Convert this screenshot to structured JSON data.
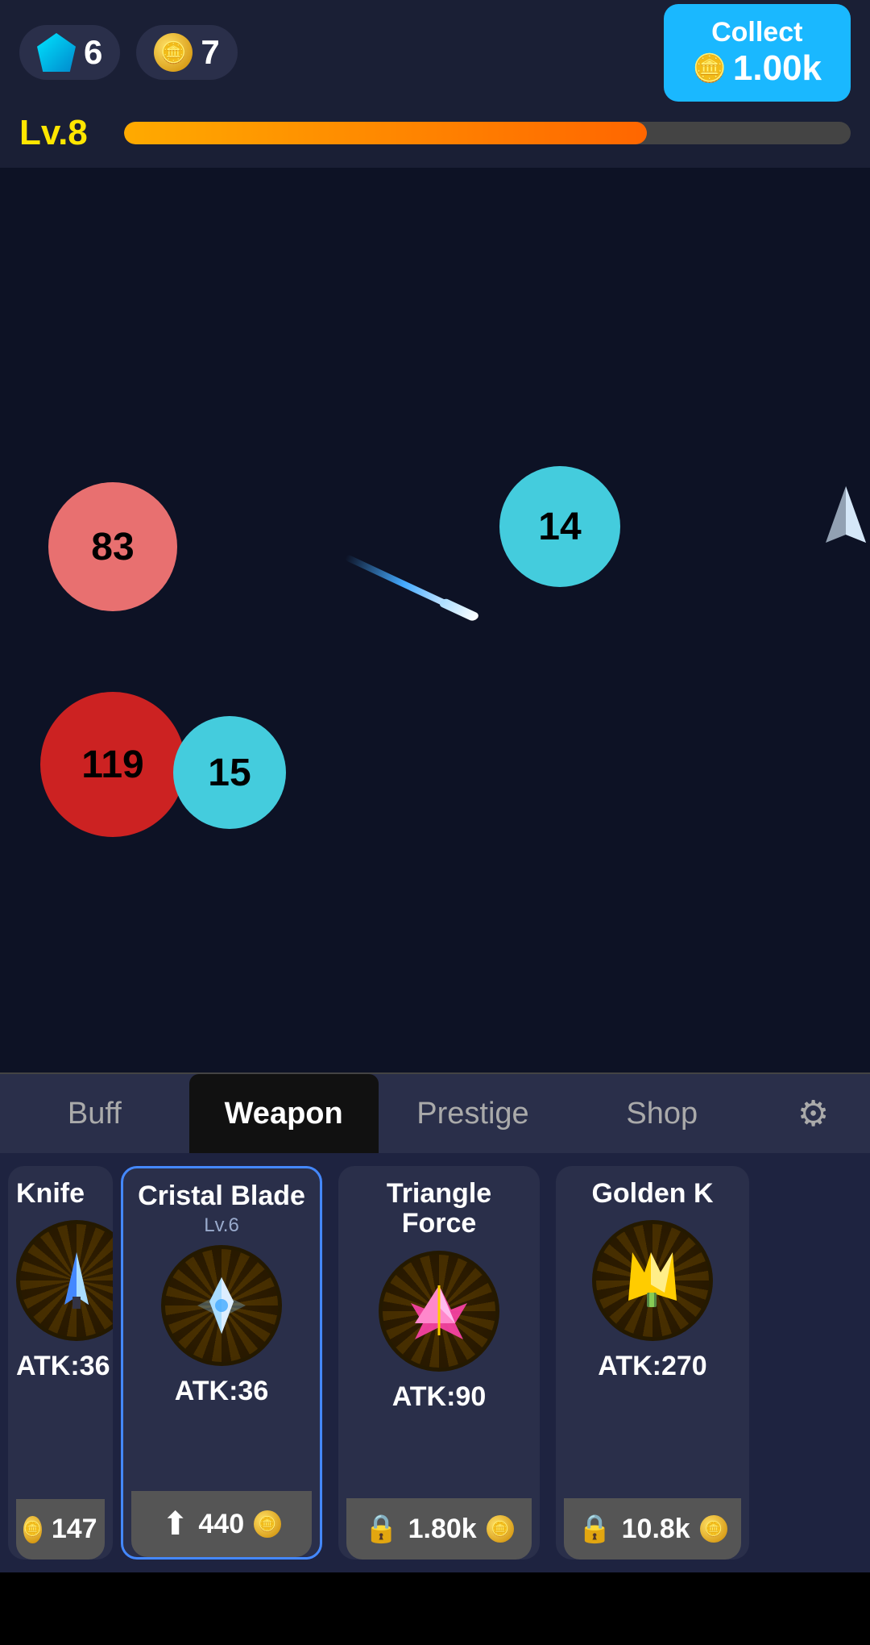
{
  "topbar": {
    "diamond_count": "6",
    "coin_count": "7",
    "collect_label": "Collect",
    "collect_amount": "1.00k"
  },
  "level": {
    "label": "Lv.8",
    "xp_percent": 72
  },
  "game": {
    "enemies": [
      {
        "id": "enemy-83",
        "value": "83"
      },
      {
        "id": "enemy-119",
        "value": "119"
      },
      {
        "id": "enemy-15",
        "value": "15"
      },
      {
        "id": "enemy-14",
        "value": "14"
      }
    ]
  },
  "tabs": [
    {
      "id": "tab-buff",
      "label": "Buff",
      "active": false
    },
    {
      "id": "tab-weapon",
      "label": "Weapon",
      "active": true
    },
    {
      "id": "tab-prestige",
      "label": "Prestige",
      "active": false
    },
    {
      "id": "tab-shop",
      "label": "Shop",
      "active": false
    },
    {
      "id": "tab-settings",
      "label": "⚙",
      "active": false
    }
  ],
  "weapons": [
    {
      "id": "weapon-knife",
      "name": "Knife",
      "level": "",
      "atk": "ATK:36",
      "action_type": "coin",
      "action_value": "147",
      "partial": true,
      "active": false
    },
    {
      "id": "weapon-cristal-blade",
      "name": "Cristal Blade",
      "level": "Lv.6",
      "atk": "ATK:36",
      "action_type": "upgrade",
      "action_value": "440",
      "partial": false,
      "active": true
    },
    {
      "id": "weapon-triangle-force",
      "name": "Triangle Force",
      "level": "",
      "atk": "ATK:90",
      "action_type": "lock",
      "action_value": "1.80k",
      "partial": false,
      "active": false
    },
    {
      "id": "weapon-golden-k",
      "name": "Golden K",
      "level": "",
      "atk": "ATK:270",
      "action_type": "lock",
      "action_value": "10.8k",
      "partial": true,
      "active": false
    }
  ]
}
